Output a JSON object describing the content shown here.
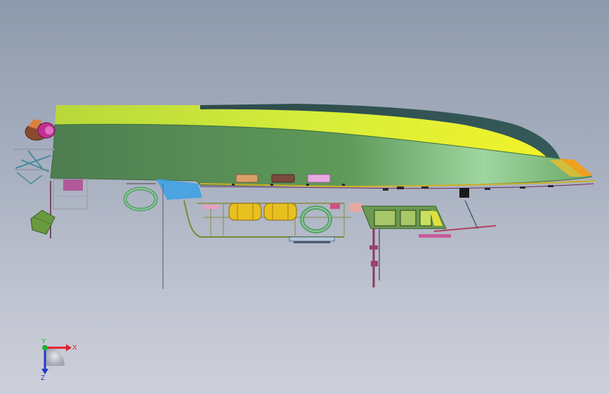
{
  "view": {
    "background_top": "#8e9aac",
    "background_bottom": "#cdd0da",
    "model_colors": {
      "hull_upper": "#c8e63a",
      "hull_side": "#4f8a4e",
      "hull_dark": "#2f4f4a",
      "bow_tip": "#f0a020",
      "panel_orange": "#d9a06a",
      "panel_brown": "#7a4a40",
      "panel_pink": "#e8a8e0",
      "tank": "#e8c020",
      "cabin": "#7a9a58",
      "strut_blue": "#3aa0e8",
      "magenta": "#c0308a"
    }
  },
  "triad": {
    "x_label": "X",
    "y_label": "Y",
    "z_label": "Z",
    "x_color": "#e0202a",
    "y_color": "#20b040",
    "z_color": "#2838c8"
  }
}
